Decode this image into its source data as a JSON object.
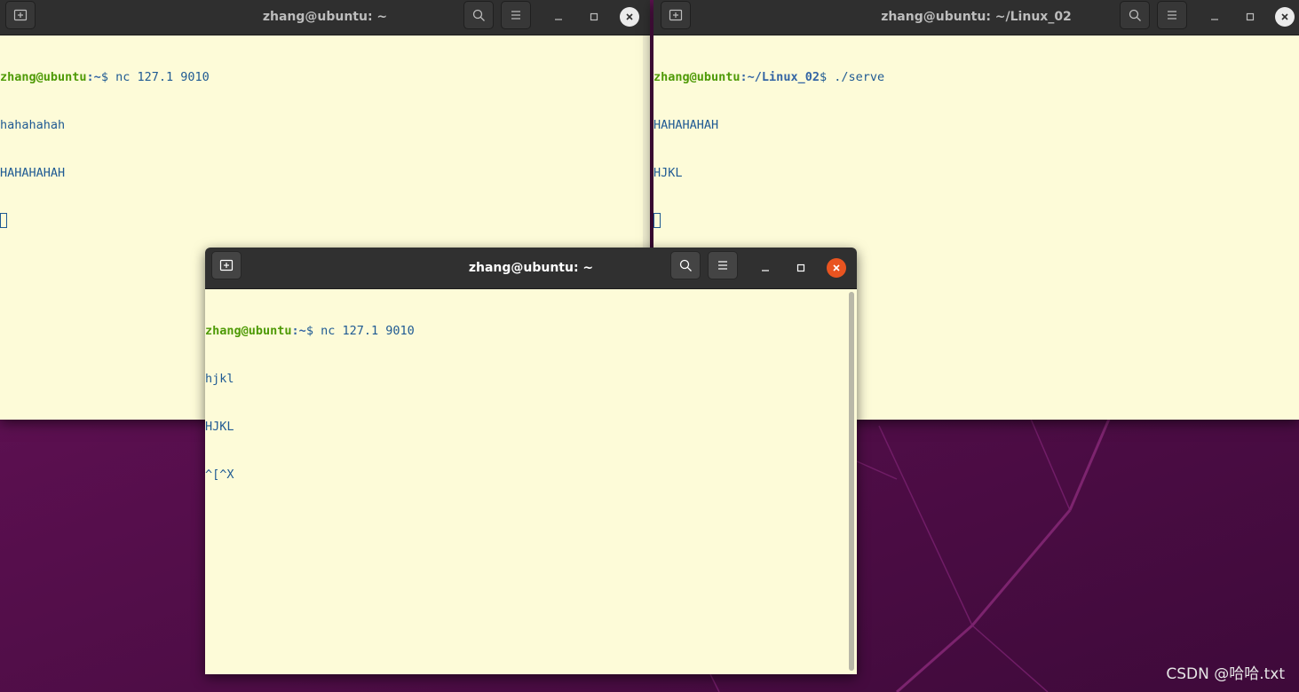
{
  "watermark": "CSDN @哈哈.txt",
  "windows": {
    "left": {
      "title": "zhang@ubuntu: ~",
      "prompt_user": "zhang@ubuntu",
      "prompt_path": ":~",
      "prompt_symbol": "$ ",
      "command": "nc 127.1 9010",
      "output": [
        "hahahahah",
        "HAHAHAHAH"
      ]
    },
    "right": {
      "title": "zhang@ubuntu: ~/Linux_02",
      "prompt_user": "zhang@ubuntu",
      "prompt_path": ":~/Linux_02",
      "prompt_symbol": "$ ",
      "command": "./serve",
      "output": [
        "HAHAHAHAH",
        "HJKL"
      ]
    },
    "front": {
      "title": "zhang@ubuntu: ~",
      "prompt_user": "zhang@ubuntu",
      "prompt_path": ":~",
      "prompt_symbol": "$ ",
      "command": "nc 127.1 9010",
      "output": [
        "hjkl",
        "HJKL",
        "^[^X"
      ]
    }
  },
  "icons": {
    "new_tab": "new-tab-icon",
    "search": "search-icon",
    "menu": "hamburger-menu-icon",
    "minimize": "minimize-icon",
    "maximize": "maximize-icon",
    "close": "close-icon"
  },
  "colors": {
    "terminal_bg": "#fdfbd8",
    "titlebar_bg": "#303030",
    "prompt_user": "#4e9a06",
    "prompt_path": "#3465a4",
    "text": "#1f5a93",
    "close_active": "#e95420",
    "desktop": "#5a0f4f"
  }
}
